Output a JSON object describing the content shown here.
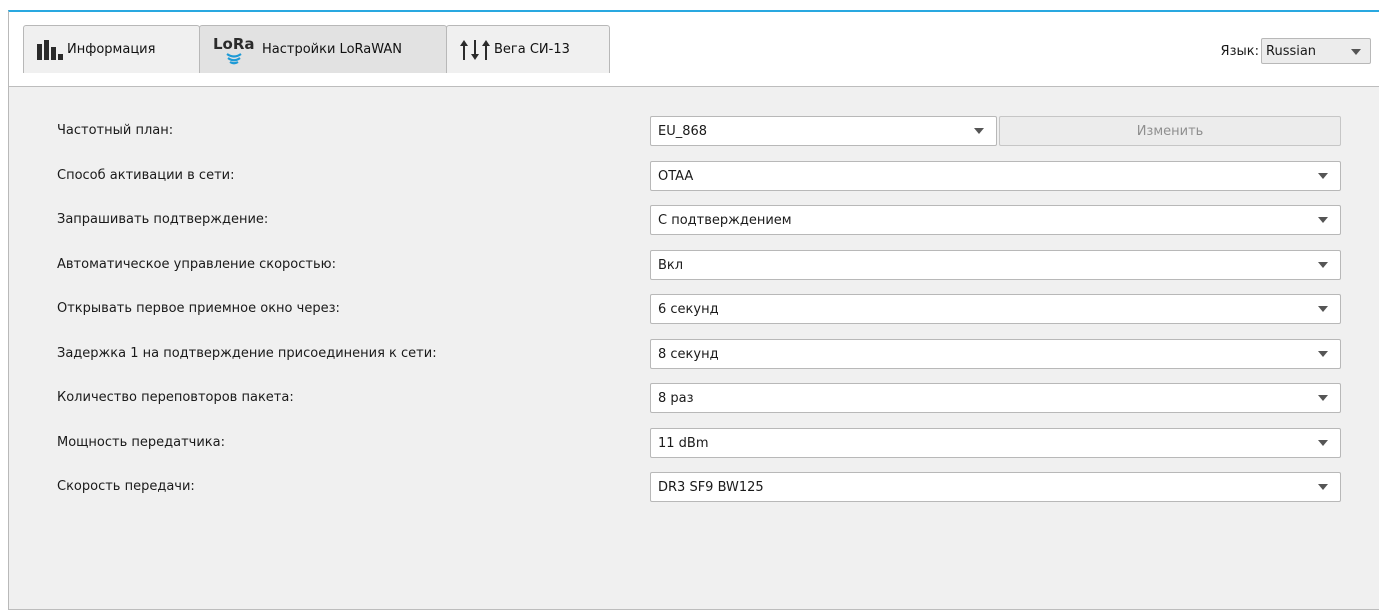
{
  "tabs": [
    {
      "label": "Информация",
      "icon": "bar-chart-icon",
      "active": false
    },
    {
      "label": "Настройки LoRaWAN",
      "icon": "lora-logo-icon",
      "logo_text": "LoRa",
      "active": true
    },
    {
      "label": "Вега СИ-13",
      "icon": "arrows-up-down-icon",
      "active": false
    }
  ],
  "language": {
    "label": "Язык:",
    "value": "Russian"
  },
  "settings": [
    {
      "label": "Частотный план:",
      "value": "EU_868"
    },
    {
      "label": "Способ активации в сети:",
      "value": "OTAA"
    },
    {
      "label": "Запрашивать подтверждение:",
      "value": "С подтверждением"
    },
    {
      "label": "Автоматическое управление скоростью:",
      "value": "Вкл"
    },
    {
      "label": "Открывать первое приемное окно через:",
      "value": "6 секунд"
    },
    {
      "label": "Задержка 1 на подтверждение присоединения к сети:",
      "value": "8 секунд"
    },
    {
      "label": "Количество переповторов пакета:",
      "value": "8 раз"
    },
    {
      "label": "Мощность передатчика:",
      "value": "11 dBm"
    },
    {
      "label": "Скорость передачи:",
      "value": "DR3 SF9 BW125"
    }
  ],
  "change_button": {
    "label": "Изменить",
    "enabled": false
  },
  "colors": {
    "accent": "#29a8e0",
    "lora_blue": "#1d9ad6",
    "icon_dark": "#2b2b2b"
  }
}
